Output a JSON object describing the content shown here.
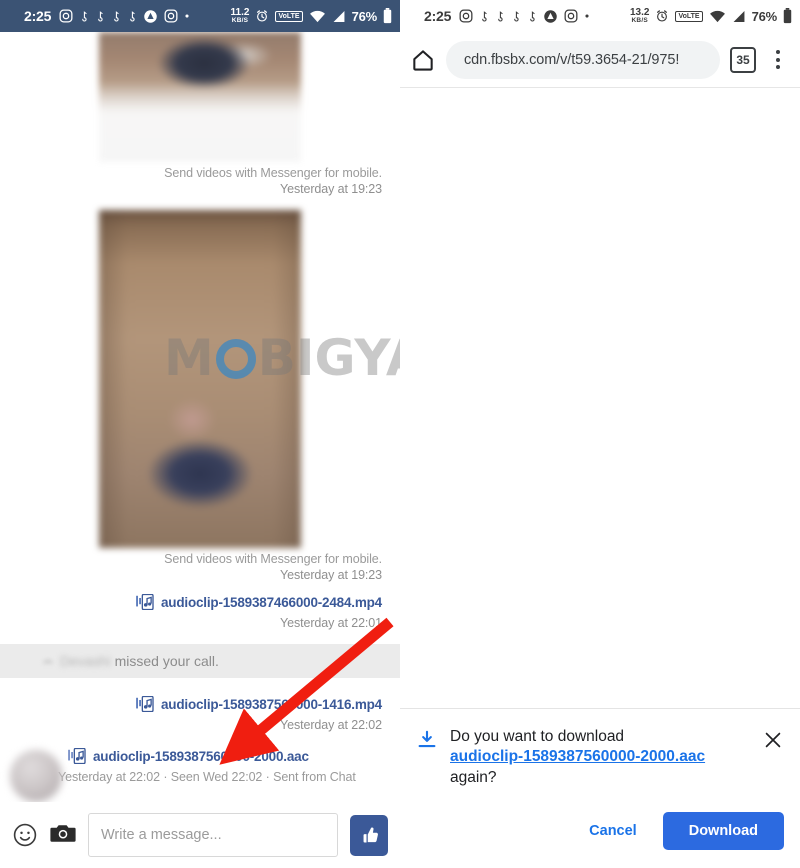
{
  "left_panel": {
    "statusbar": {
      "time": "2:25",
      "icons": [
        "instagram-icon",
        "tiktok-icon",
        "tiktok-icon",
        "tiktok-icon",
        "tiktok-icon",
        "avg-icon",
        "instagram-icon",
        "dot-icon"
      ],
      "data_rate_value": "11.2",
      "data_rate_unit": "KB/S",
      "alarm": "alarm-icon",
      "volte": "VoLTE",
      "wifi": "wifi-icon",
      "signal": "signal-icon",
      "battery_percent": "76%",
      "battery": "battery-icon"
    },
    "messages": [
      {
        "type": "video",
        "caption": "Send videos with Messenger for mobile.",
        "timestamp": "Yesterday at 19:23"
      },
      {
        "type": "video",
        "caption": "Send videos with Messenger for mobile.",
        "timestamp": "Yesterday at 19:23"
      },
      {
        "type": "file",
        "filename": "audioclip-1589387466000-2484.mp4",
        "timestamp": "Yesterday at 22:01"
      },
      {
        "type": "missed_call",
        "name": "Devashi",
        "text": "missed your call."
      },
      {
        "type": "file",
        "filename": "audioclip-1589387560000-1416.mp4",
        "timestamp": "Yesterday at 22:02"
      },
      {
        "type": "file_incoming",
        "filename": "audioclip-1589387560000-2000.aac",
        "meta": "Yesterday at 22:02 · Seen Wed 22:02 · Sent from Chat"
      }
    ],
    "composer": {
      "emoji_icon": "smiley-icon",
      "camera_icon": "camera-icon",
      "placeholder": "Write a message...",
      "value": "",
      "like_icon": "thumbs-up-icon"
    },
    "watermark": {
      "text_before": "M",
      "text_after": "BIGYAAN",
      "accent_color": "#3886c4"
    }
  },
  "right_panel": {
    "statusbar": {
      "time": "2:25",
      "data_rate_value": "13.2",
      "data_rate_unit": "KB/S",
      "volte": "VoLTE",
      "battery_percent": "76%"
    },
    "browser": {
      "home_icon": "home-icon",
      "url": "cdn.fbsbx.com/v/t59.3654-21/975!",
      "tab_count": "35",
      "menu_icon": "kebab-menu-icon"
    },
    "download_dialog": {
      "download_icon": "download-icon",
      "question_prefix": "Do you want to download",
      "filename": "audioclip-1589387560000-2000.aac",
      "question_suffix": "again?",
      "close_icon": "close-icon",
      "cancel_label": "Cancel",
      "download_label": "Download",
      "accent_color": "#2c6ae0"
    }
  },
  "annotation": {
    "arrow_color": "#f01e10"
  }
}
